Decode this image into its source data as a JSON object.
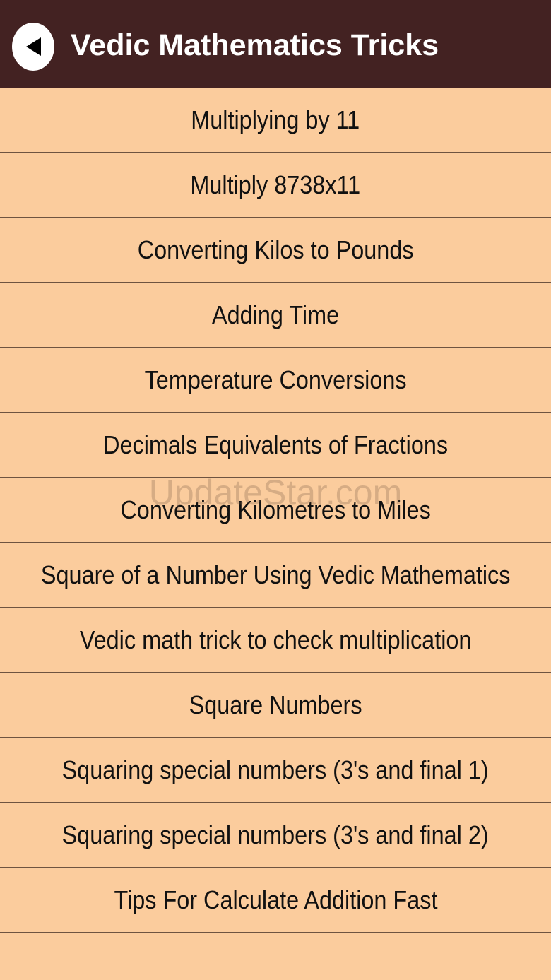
{
  "header": {
    "title": "Vedic Mathematics Tricks",
    "back_icon": "back-arrow-icon",
    "background_color": "#432222"
  },
  "list": {
    "background_color": "#fbcc9d",
    "items": [
      {
        "label": "Multiplying by 11"
      },
      {
        "label": "Multiply 8738x11"
      },
      {
        "label": "Converting Kilos to Pounds"
      },
      {
        "label": "Adding Time"
      },
      {
        "label": "Temperature Conversions"
      },
      {
        "label": "Decimals Equivalents of Fractions"
      },
      {
        "label": "Converting Kilometres to Miles"
      },
      {
        "label": "Square of a Number Using Vedic Mathematics"
      },
      {
        "label": "Vedic math trick to check multiplication"
      },
      {
        "label": "Square Numbers"
      },
      {
        "label": "Squaring special numbers (3's and final 1)"
      },
      {
        "label": "Squaring special numbers (3's and final 2)"
      },
      {
        "label": "Tips For Calculate Addition Fast"
      }
    ]
  },
  "watermark": {
    "text": "UpdateStar.com"
  }
}
